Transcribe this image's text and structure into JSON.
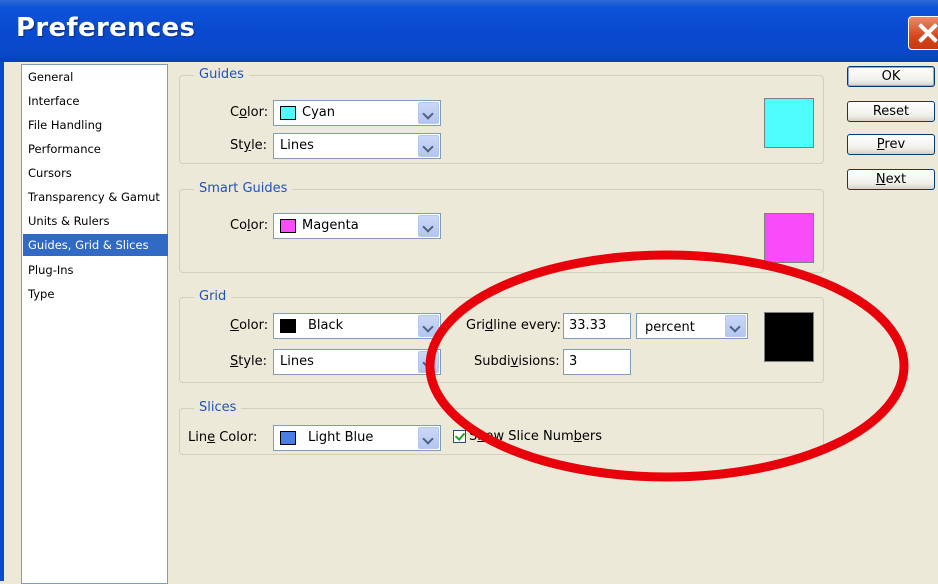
{
  "window": {
    "title": "Preferences"
  },
  "sidebar": {
    "items": [
      {
        "label": "General"
      },
      {
        "label": "Interface"
      },
      {
        "label": "File Handling"
      },
      {
        "label": "Performance"
      },
      {
        "label": "Cursors"
      },
      {
        "label": "Transparency & Gamut"
      },
      {
        "label": "Units & Rulers"
      },
      {
        "label": "Guides, Grid & Slices",
        "selected": true
      },
      {
        "label": "Plug-Ins"
      },
      {
        "label": "Type"
      }
    ]
  },
  "guides": {
    "title": "Guides",
    "color_label_pre": "C",
    "color_label_ul": "o",
    "color_label_post": "lor:",
    "color_value": "Cyan",
    "color_hex": "#4dfcfc",
    "style_label_pre": "St",
    "style_label_ul": "y",
    "style_label_post": "le:",
    "style_value": "Lines"
  },
  "smart_guides": {
    "title": "Smart Guides",
    "color_label_pre": "Co",
    "color_label_ul": "l",
    "color_label_post": "or:",
    "color_value": "Magenta",
    "color_hex": "#f94cf9"
  },
  "grid": {
    "title": "Grid",
    "color_label_pre": "",
    "color_label_ul": "C",
    "color_label_post": "olor:",
    "color_value": "Black",
    "color_hex": "#000000",
    "style_label_pre": "",
    "style_label_ul": "S",
    "style_label_post": "tyle:",
    "style_value": "Lines",
    "gridline_label_pre": "Gri",
    "gridline_label_ul": "d",
    "gridline_label_post": "line every:",
    "gridline_value": "33.33",
    "gridline_unit": "percent",
    "subdivisions_label_pre": "Subdi",
    "subdivisions_label_ul": "v",
    "subdivisions_label_post": "isions:",
    "subdivisions_value": "3"
  },
  "slices": {
    "title": "Slices",
    "line_color_label_pre": "Lin",
    "line_color_label_ul": "e",
    "line_color_label_post": " Color:",
    "line_color_value": "Light Blue",
    "line_color_hex": "#4a7ee6",
    "show_numbers_pre": "S",
    "show_numbers_ul": "h",
    "show_numbers_post": "ow Slice Num",
    "show_numbers_ul2": "b",
    "show_numbers_post2": "ers",
    "show_numbers_checked": true
  },
  "buttons": {
    "ok": "OK",
    "reset": "Reset",
    "prev_ul": "P",
    "prev_post": "rev",
    "next_ul": "N",
    "next_post": "ext"
  },
  "annotation": {
    "color": "#e8000b",
    "shape": "ellipse"
  }
}
